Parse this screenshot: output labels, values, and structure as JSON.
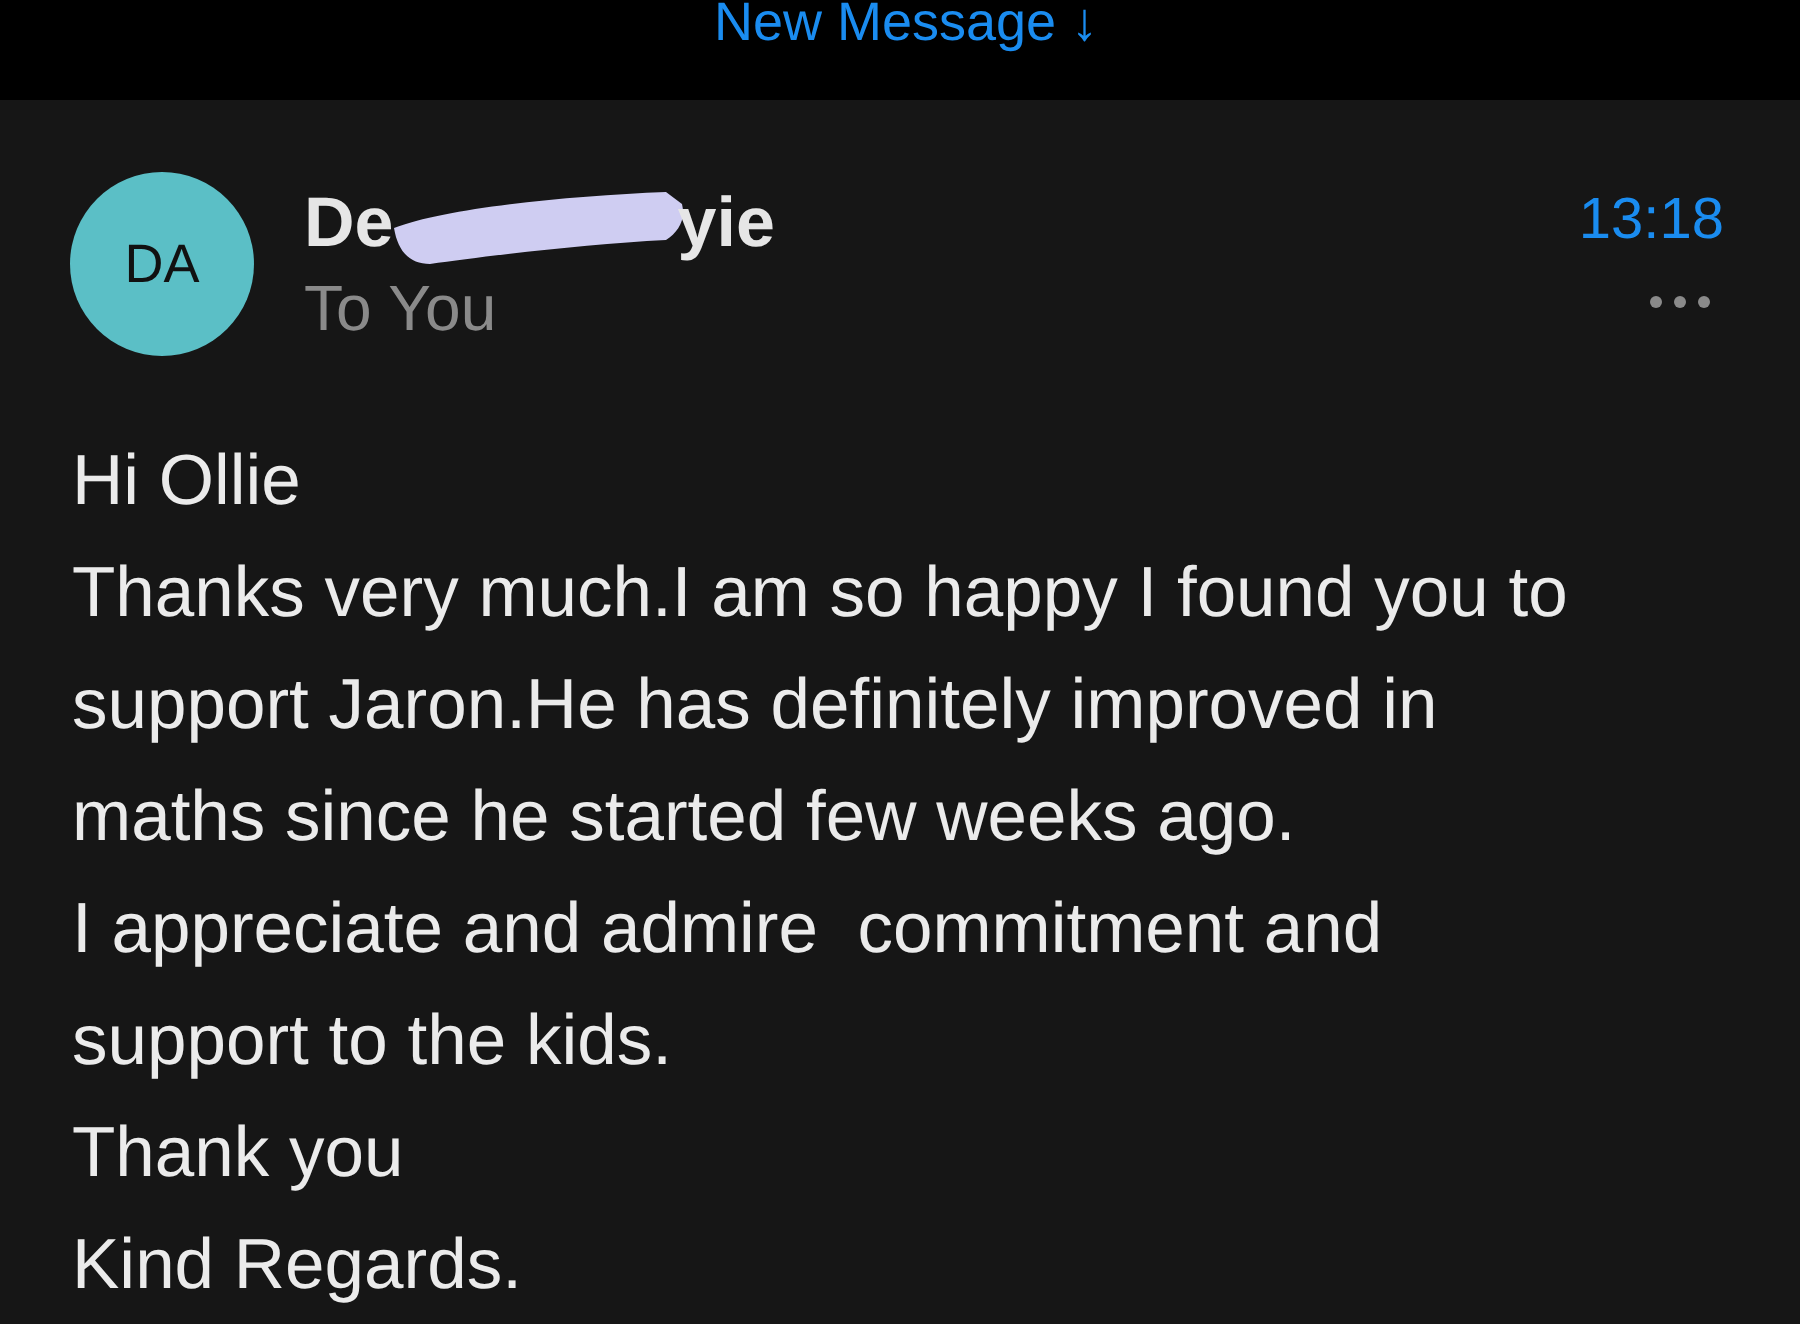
{
  "top_bar": {
    "label": "New Message ↓"
  },
  "message": {
    "avatar": {
      "initials": "DA",
      "color": "#5bbfc6"
    },
    "sender_start": "De",
    "sender_end": "yie",
    "recipient": "To You",
    "time": "13:18",
    "body": [
      "Hi Ollie",
      "Thanks very much.I am so happy I found you to",
      "support Jaron.He has definitely improved in",
      "maths since he started few weeks ago.",
      "I appreciate and admire  commitment and",
      "support to the kids.",
      "Thank you",
      "Kind Regards."
    ]
  }
}
